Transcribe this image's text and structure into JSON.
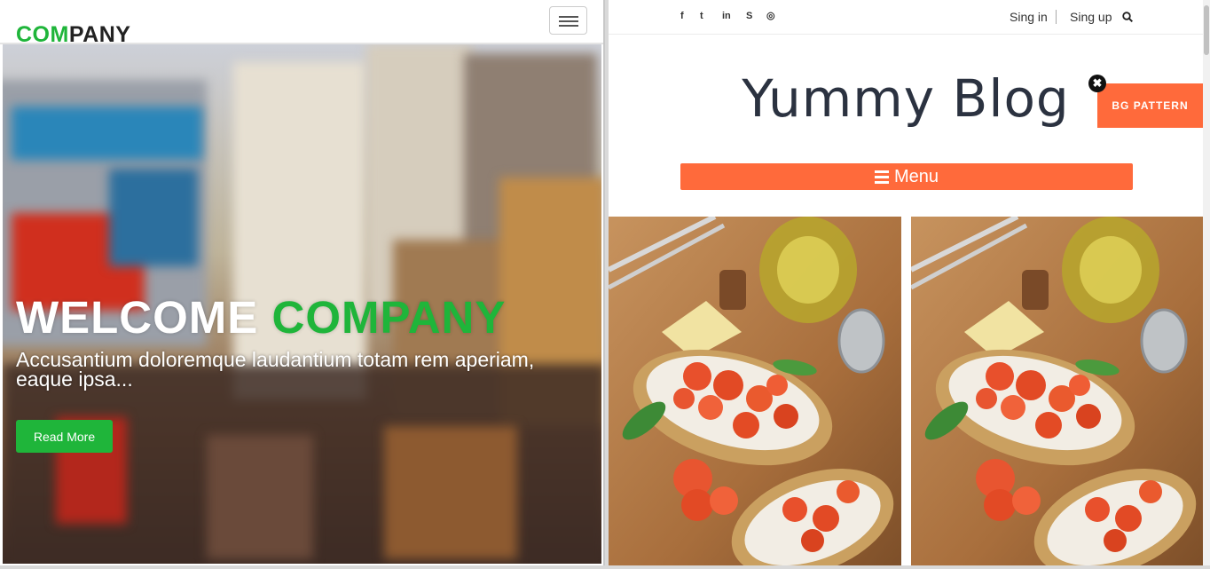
{
  "left": {
    "logo": {
      "accent": "COM",
      "rest": "PANY"
    },
    "hero": {
      "title_white": "WELCOME ",
      "title_accent": "COMPANY",
      "subtitle": "Accusantium doloremque laudantium totam rem aperiam, eaque ipsa...",
      "cta_label": "Read More"
    }
  },
  "right": {
    "social": [
      {
        "name": "facebook-icon",
        "glyph": "f"
      },
      {
        "name": "twitter-icon",
        "glyph": "t"
      },
      {
        "name": "linkedin-icon",
        "glyph": "in"
      },
      {
        "name": "skype-icon",
        "glyph": "S"
      },
      {
        "name": "dribbble-icon",
        "glyph": "◎"
      }
    ],
    "auth": {
      "signin": "Sing in",
      "signup": "Sing up"
    },
    "blog_title": "Yummy Blog",
    "close_glyph": "✖",
    "bg_pattern_label": "BG PATTERN",
    "menu_label": "Menu"
  },
  "colors": {
    "green_accent": "#1fb53a",
    "orange_accent": "#ff6a3b"
  }
}
